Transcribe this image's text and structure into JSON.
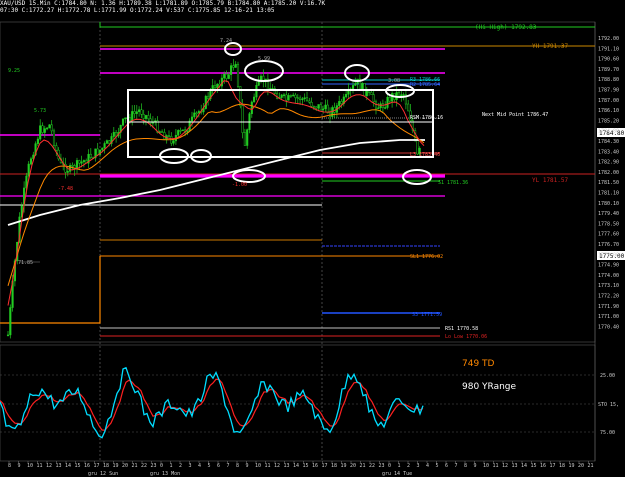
{
  "header": {
    "line1": "XAU/USD 15.Min C:1784.80 N: 1.36 H:1789.38 L:1781.89 O:1785.79 B:1784.80 A:1785.20 V:16.7K",
    "line2": "07:30 C:1772.27 H:1772.78 L:1771.99 O:1772.24 V:537 C:1775.85 12-16-21 13:05"
  },
  "price_axis": [
    "1792.00",
    "1791.10",
    "1790.60",
    "1789.70",
    "1788.80",
    "1787.90",
    "1787.00",
    "1786.10",
    "1785.20",
    "1784.80",
    "1784.30",
    "1783.40",
    "1782.90",
    "1782.00",
    "1781.50",
    "1781.10",
    "1780.10",
    "1779.40",
    "1778.50",
    "1777.60",
    "1776.70",
    "1775.00",
    "1774.90",
    "1774.00",
    "1773.10",
    "1772.20",
    "1771.90",
    "1771.00",
    "1770.40"
  ],
  "osc_axis": [
    "25.00",
    "STO 15,",
    "75.00"
  ],
  "time_axis": [
    "8",
    "9",
    "10",
    "11",
    "12",
    "13",
    "14",
    "15",
    "16",
    "17",
    "18",
    "19",
    "20",
    "21",
    "22",
    "23",
    "0",
    "1",
    "2",
    "3",
    "4",
    "5",
    "6",
    "7",
    "8",
    "9",
    "10",
    "11",
    "12",
    "13",
    "14",
    "15",
    "16",
    "17",
    "18",
    "19",
    "20",
    "21",
    "22",
    "23",
    "0",
    "1",
    "2",
    "3",
    "4",
    "5",
    "6",
    "7",
    "8",
    "9",
    "10",
    "11",
    "12",
    "13",
    "14",
    "15",
    "16",
    "17",
    "18",
    "19",
    "20",
    "21"
  ],
  "date_labels": [
    "gru 12 Sun",
    "gru 13 Mon",
    "gru 14 Tue"
  ],
  "levels": {
    "hi_high": "(Hi High) 1792.83",
    "yh": "YH 1791.37",
    "r3": "R3 1786.66",
    "r2": "R2 1785.64",
    "r1": "R1 1785.34",
    "rsm": "RSM 1786.16",
    "next_mid": "Next Mid Point 1786.47",
    "l3": "L3 1783.46",
    "yl": "YL 1781.57",
    "s1": "S1 1781.36",
    "sl1": "SL1 1776.02",
    "s3": "S3 1771.59",
    "rs1": "RS1 1770.58",
    "lo_low": "Lo Low 1770.06",
    "left_a": "9.25",
    "left_b": "5.73",
    "left_c": "71.85",
    "left_d": "-7.48",
    "mid_a": "7.24",
    "mid_b": "5.99",
    "mid_c": "3.08",
    "mid_d": "-1.00"
  },
  "info": {
    "td": "749 TD",
    "yrange": "980 YRange"
  },
  "colors": {
    "candle": "#22cc22",
    "ma_red": "#ff3030",
    "ma_orange": "#ff8800",
    "ma_white": "#ffffff",
    "magenta": "#ff00ff",
    "stoch_k": "#00ddff",
    "stoch_d": "#ff2020"
  }
}
